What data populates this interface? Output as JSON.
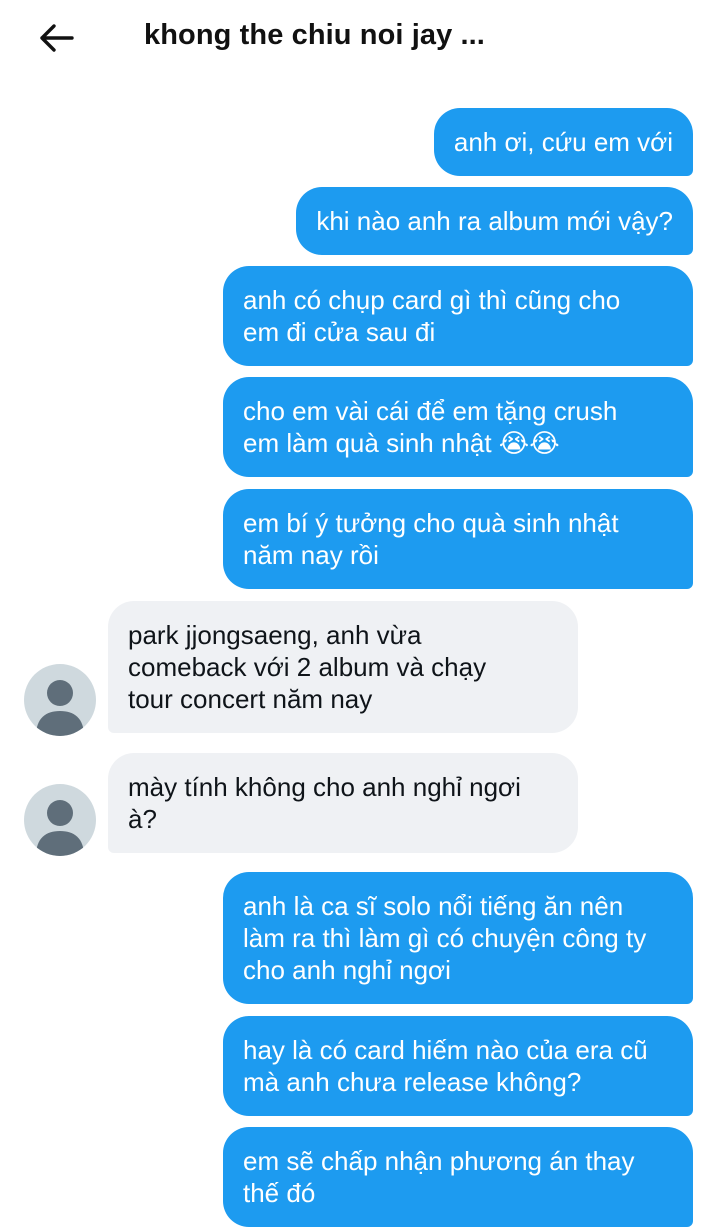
{
  "header": {
    "title": "khong the chiu noi jay ...",
    "back_icon": "arrow-left-icon"
  },
  "colors": {
    "outgoing_bubble": "#1d9bf0",
    "incoming_bubble": "#eff1f4",
    "avatar_placeholder": "#cfd9de"
  },
  "messages": [
    {
      "direction": "out",
      "text": "anh ơi, cứu em với"
    },
    {
      "direction": "out",
      "text": "khi nào anh ra album mới vậy?"
    },
    {
      "direction": "out",
      "text": "anh có chụp card gì thì cũng cho\nem đi cửa sau đi"
    },
    {
      "direction": "out",
      "text": "cho em vài cái để em tặng crush\nem làm quà sinh nhật 😭😭"
    },
    {
      "direction": "out",
      "text": "em bí ý tưởng cho quà sinh nhật\nnăm nay rồi"
    },
    {
      "direction": "in",
      "text": "park jjongsaeng, anh vừa\ncomeback với 2 album và chạy\ntour concert năm nay",
      "avatar_icon": "default-avatar-icon"
    },
    {
      "direction": "in",
      "text": "mày tính không cho anh nghỉ ngơi\nà?",
      "avatar_icon": "default-avatar-icon"
    },
    {
      "direction": "out",
      "text": "anh là ca sĩ solo nổi tiếng ăn nên\nlàm ra thì làm gì có chuyện công ty\ncho anh nghỉ ngơi"
    },
    {
      "direction": "out",
      "text": "hay là có card hiếm nào của era cũ\nmà anh chưa release không?"
    },
    {
      "direction": "out",
      "text": "em sẽ chấp nhận phương án thay\nthế đó"
    }
  ]
}
